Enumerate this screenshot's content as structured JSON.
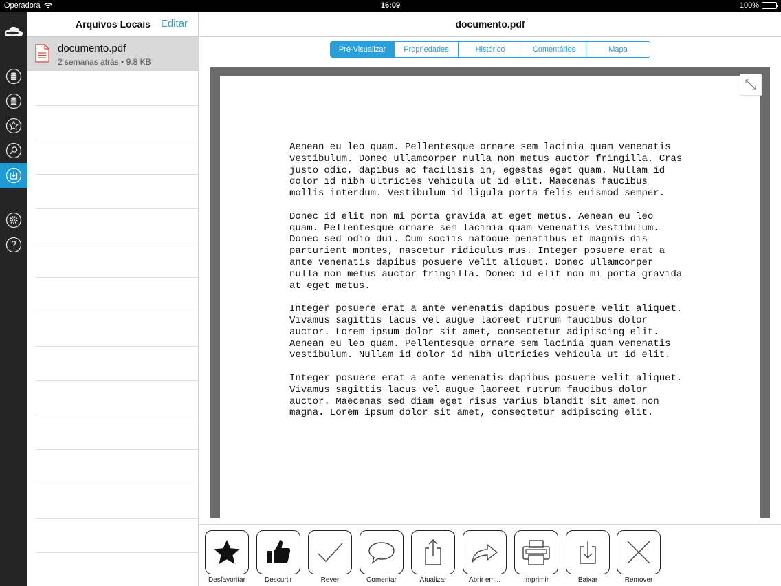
{
  "status_bar": {
    "carrier": "Operadora",
    "time": "16:09",
    "battery": "100%"
  },
  "rail": {
    "items": [
      {
        "name": "storage-icon"
      },
      {
        "name": "storage-icon-2"
      },
      {
        "name": "star-icon"
      },
      {
        "name": "search-icon"
      },
      {
        "name": "download-icon",
        "active": true
      },
      {
        "name": "gear-icon"
      },
      {
        "name": "help-icon"
      }
    ]
  },
  "list": {
    "title": "Arquivos Locais",
    "edit_label": "Editar",
    "files": [
      {
        "name": "documento.pdf",
        "meta": "2 semanas atrás • 9.8 KB"
      }
    ]
  },
  "main": {
    "title": "documento.pdf",
    "tabs": [
      {
        "label": "Pré-Visualizar",
        "active": true
      },
      {
        "label": "Propriedades"
      },
      {
        "label": "Histórico"
      },
      {
        "label": "Comentários"
      },
      {
        "label": "Mapa"
      }
    ],
    "document": {
      "paragraphs": [
        "Aenean eu leo quam. Pellentesque ornare sem lacinia quam venenatis\nvestibulum. Donec ullamcorper nulla non metus auctor fringilla. Cras\njusto odio, dapibus ac facilisis in, egestas eget quam. Nullam id\ndolor id nibh ultricies vehicula ut id elit. Maecenas faucibus\nmollis interdum. Vestibulum id ligula porta felis euismod semper.",
        "Donec id elit non mi porta gravida at eget metus. Aenean eu leo\nquam. Pellentesque ornare sem lacinia quam venenatis vestibulum.\nDonec sed odio dui. Cum sociis natoque penatibus et magnis dis\nparturient montes, nascetur ridiculus mus. Integer posuere erat a\nante venenatis dapibus posuere velit aliquet. Donec ullamcorper\nnulla non metus auctor fringilla. Donec id elit non mi porta gravida\nat eget metus.",
        "Integer posuere erat a ante venenatis dapibus posuere velit aliquet.\nVivamus sagittis lacus vel augue laoreet rutrum faucibus dolor\nauctor. Lorem ipsum dolor sit amet, consectetur adipiscing elit.\nAenean eu leo quam. Pellentesque ornare sem lacinia quam venenatis\nvestibulum. Nullam id dolor id nibh ultricies vehicula ut id elit.",
        "Integer posuere erat a ante venenatis dapibus posuere velit aliquet.\nVivamus sagittis lacus vel augue laoreet rutrum faucibus dolor\nauctor. Maecenas sed diam eget risus varius blandit sit amet non\nmagna. Lorem ipsum dolor sit amet, consectetur adipiscing elit."
      ]
    }
  },
  "toolbar": {
    "actions": [
      {
        "label": "Desfavoritar",
        "icon": "star-filled-icon"
      },
      {
        "label": "Descurtir",
        "icon": "thumbs-up-icon"
      },
      {
        "label": "Rever",
        "icon": "checkmark-icon"
      },
      {
        "label": "Comentar",
        "icon": "speech-bubble-icon"
      },
      {
        "label": "Atualizar",
        "icon": "upload-icon"
      },
      {
        "label": "Abrir em...",
        "icon": "share-arrow-icon"
      },
      {
        "label": "Imprimir",
        "icon": "printer-icon"
      },
      {
        "label": "Baixar",
        "icon": "download-tray-icon"
      },
      {
        "label": "Remover",
        "icon": "x-icon"
      }
    ]
  },
  "colors": {
    "accent": "#2a9fd8",
    "rail_bg": "#252525",
    "rail_active": "#1d9ad6",
    "viewer_bg": "#6b6b6b",
    "selected_row": "#d8d8d8"
  }
}
